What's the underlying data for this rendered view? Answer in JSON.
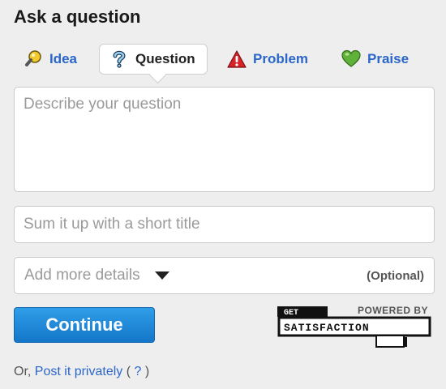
{
  "header": {
    "title": "Ask a question"
  },
  "tabs": [
    {
      "label": "Idea",
      "icon": "lightbulb-icon"
    },
    {
      "label": "Question",
      "icon": "question-mark-icon",
      "active": true
    },
    {
      "label": "Problem",
      "icon": "warning-triangle-icon"
    },
    {
      "label": "Praise",
      "icon": "heart-icon"
    }
  ],
  "form": {
    "description_placeholder": "Describe your question",
    "summary_placeholder": "Sum it up with a short title",
    "details_label": "Add more details",
    "details_optional": "(Optional)",
    "continue_label": "Continue"
  },
  "branding": {
    "powered_by": "POWERED BY",
    "get": "GET",
    "satisfaction": "SATISFACTION"
  },
  "footer": {
    "prefix": "Or,",
    "private_link": "Post it privately",
    "help_open": "(",
    "help_link": "?",
    "help_close": ")"
  },
  "colors": {
    "link": "#2b66c9",
    "button": "#1a86d8",
    "warning": "#d9232a",
    "heart": "#5fb13a"
  }
}
